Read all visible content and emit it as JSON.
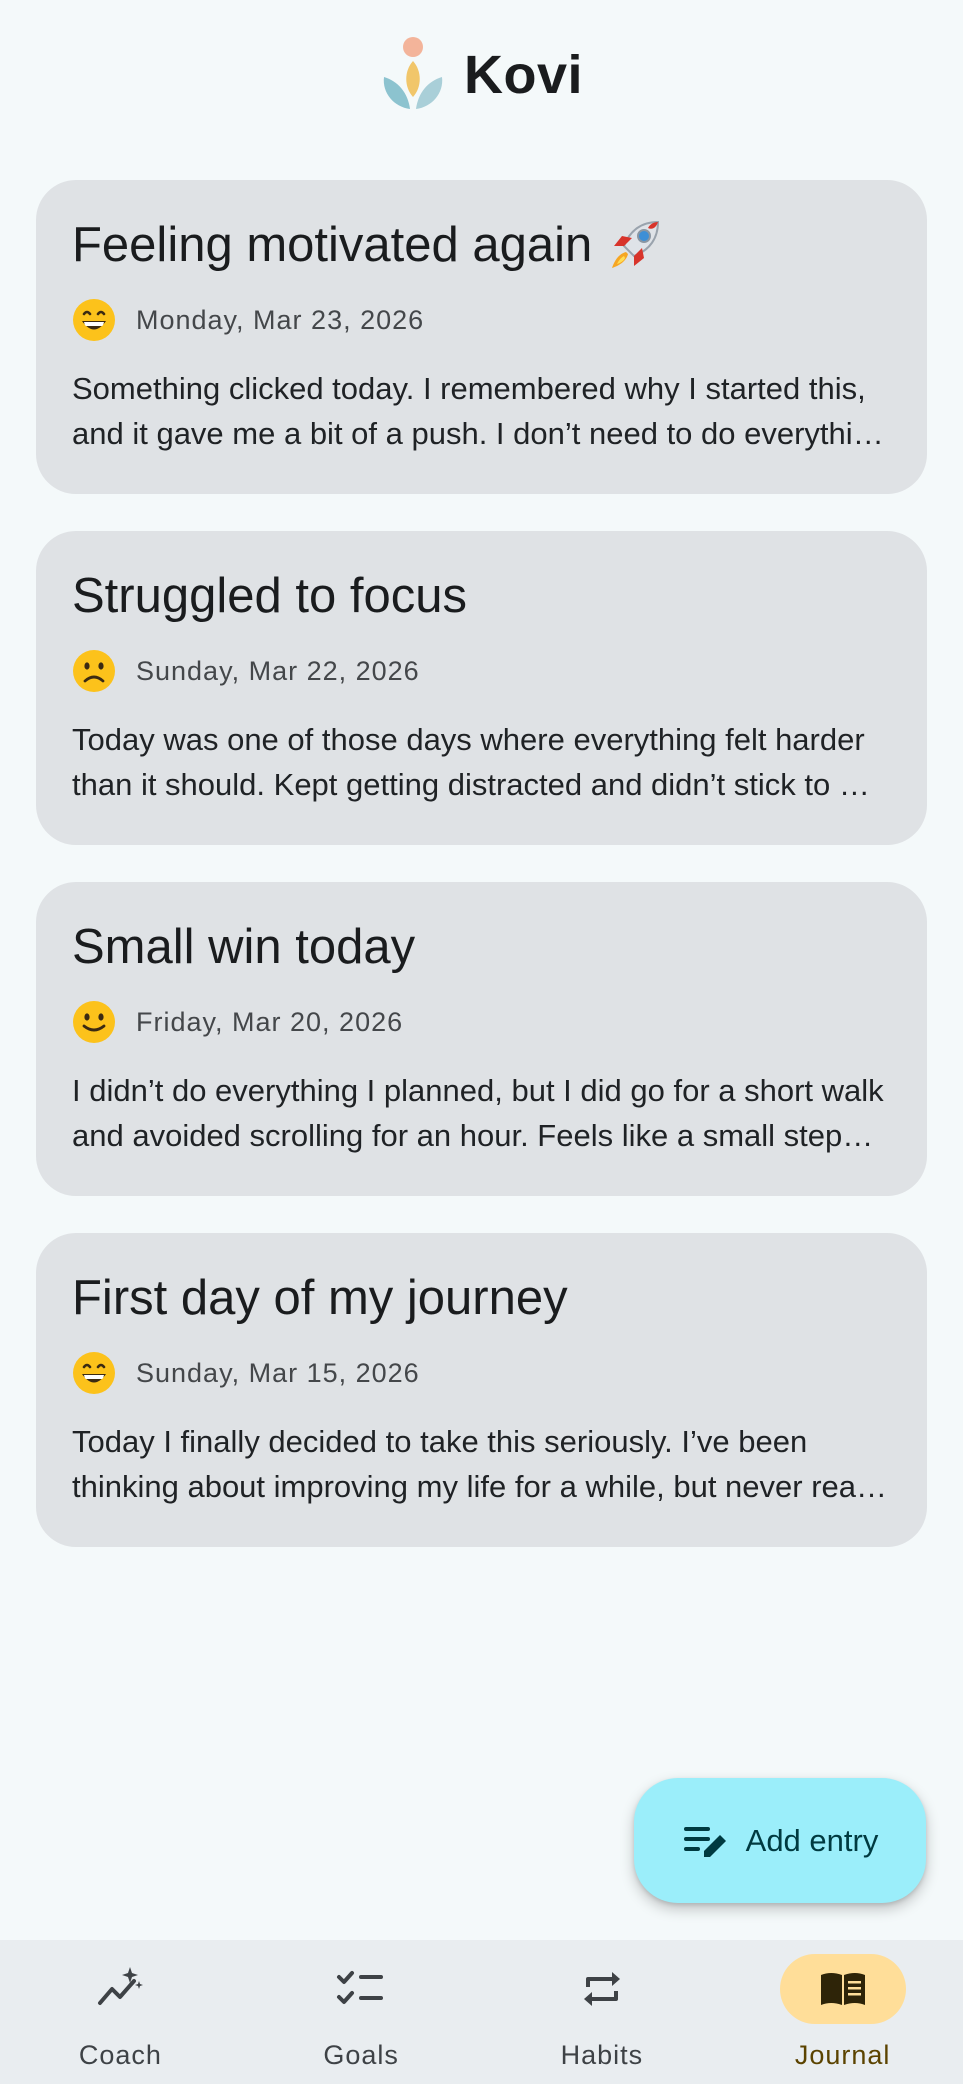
{
  "app": {
    "title": "Kovi"
  },
  "entries": [
    {
      "title": "Feeling motivated again",
      "title_emoji": "rocket",
      "mood": "grinning-face",
      "date": "Monday, Mar 23, 2026",
      "preview": "Something clicked today. I remembered why I started this, and it gave me a bit of a push. I don’t need to do everything perfectly, I just need to keep going."
    },
    {
      "title": "Struggled to focus",
      "mood": "slightly-frowning-face",
      "date": "Sunday, Mar 22, 2026",
      "preview": "Today was one of those days where everything felt harder than it should. Kept getting distracted and didn’t stick to my plan."
    },
    {
      "title": "Small win today",
      "mood": "slightly-smiling-face",
      "date": "Friday, Mar 20, 2026",
      "preview": "I didn’t do everything I planned, but I did go for a short walk and avoided scrolling for an hour. Feels like a small step forward."
    },
    {
      "title": "First day of my journey",
      "mood": "grinning-face",
      "date": "Sunday, Mar 15, 2026",
      "preview": "Today I finally decided to take this seriously. I’ve been thinking about improving my life for a while, but never really committed to it."
    }
  ],
  "fab": {
    "label": "Add entry",
    "icon": "edit-note-icon"
  },
  "nav": {
    "active": "journal",
    "items": [
      {
        "id": "coach",
        "label": "Coach",
        "icon": "sparkle-chart-icon"
      },
      {
        "id": "goals",
        "label": "Goals",
        "icon": "checklist-icon"
      },
      {
        "id": "habits",
        "label": "Habits",
        "icon": "repeat-icon"
      },
      {
        "id": "journal",
        "label": "Journal",
        "icon": "book-icon"
      }
    ]
  },
  "colors": {
    "background": "#f4f9fa",
    "card": "#dfe2e5",
    "fab": "#9beefa",
    "nav_active_pill": "#ffde99",
    "nav_bar": "#e9edf0"
  }
}
